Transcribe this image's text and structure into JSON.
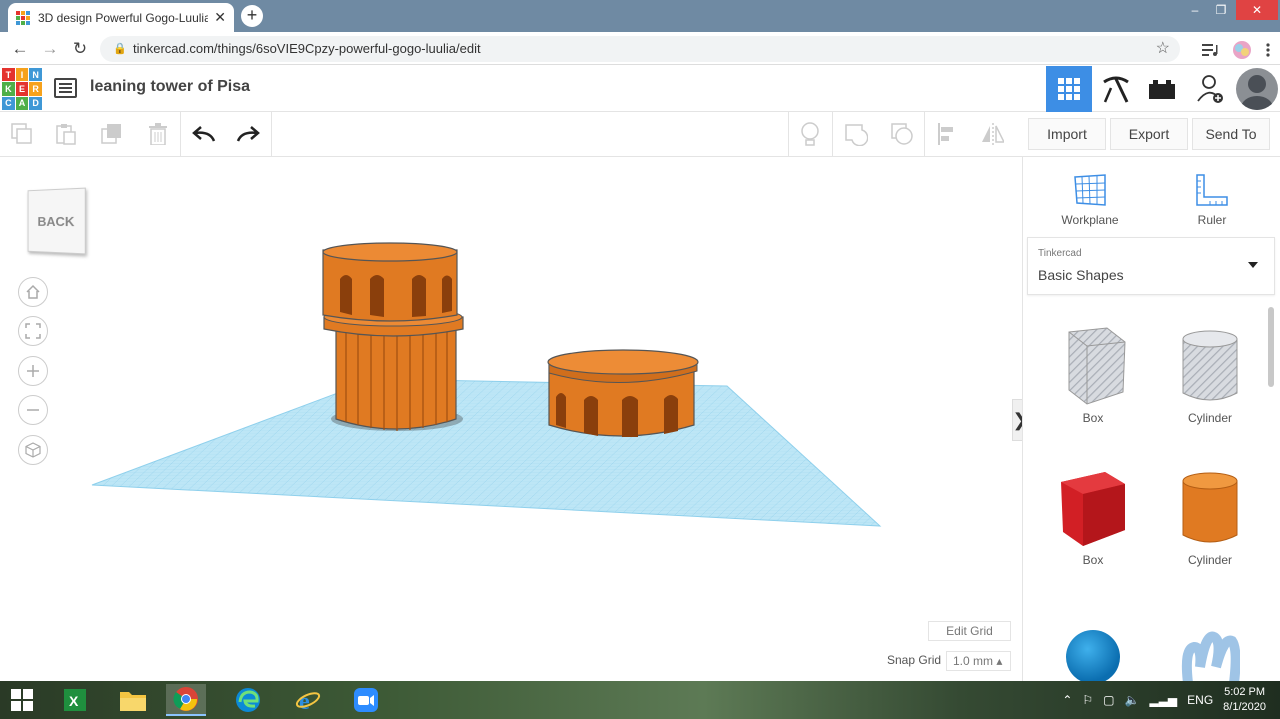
{
  "browser": {
    "tab_title": "3D design Powerful Gogo-Luulia",
    "tab_close": "✕",
    "new_tab": "+",
    "url": "tinkercad.com/things/6soVIE9Cpzy-powerful-gogo-luulia/edit",
    "window_controls": {
      "minimize": "–",
      "restore": "❐",
      "close": "✕"
    }
  },
  "app": {
    "logo_letters": [
      "T",
      "I",
      "N",
      "K",
      "E",
      "R",
      "C",
      "A",
      "D"
    ],
    "logo_colors": [
      "#e4332e",
      "#f6a21c",
      "#3f98d6",
      "#4faf48",
      "#e4332e",
      "#f6a21c",
      "#3f98d6",
      "#4faf48",
      "#3f98d6"
    ],
    "design_title": "leaning tower of Pisa"
  },
  "right_toolbar": {
    "import": "Import",
    "export": "Export",
    "send_to": "Send To"
  },
  "workspace": {
    "viewcube_face": "BACK",
    "edit_grid": "Edit Grid",
    "snap_grid_label": "Snap Grid",
    "snap_grid_value": "1.0 mm ▴",
    "collapse_icon": "❯"
  },
  "panel": {
    "workplane": "Workplane",
    "ruler": "Ruler",
    "library_source": "Tinkercad",
    "library_name": "Basic Shapes",
    "shapes": [
      {
        "label": "Box",
        "icon": "box-hole-icon"
      },
      {
        "label": "Cylinder",
        "icon": "cylinder-hole-icon"
      },
      {
        "label": "Box",
        "icon": "box-red-icon"
      },
      {
        "label": "Cylinder",
        "icon": "cylinder-orange-icon"
      },
      {
        "label": "",
        "icon": "sphere-blue-icon"
      },
      {
        "label": "",
        "icon": "scribble-icon"
      }
    ]
  },
  "taskbar": {
    "language": "ENG",
    "time": "5:02 PM",
    "date": "8/1/2020"
  },
  "colors": {
    "accent": "#3d8ee5",
    "object_orange": "#e07a22",
    "workplane_blue": "#9fd6ee"
  }
}
